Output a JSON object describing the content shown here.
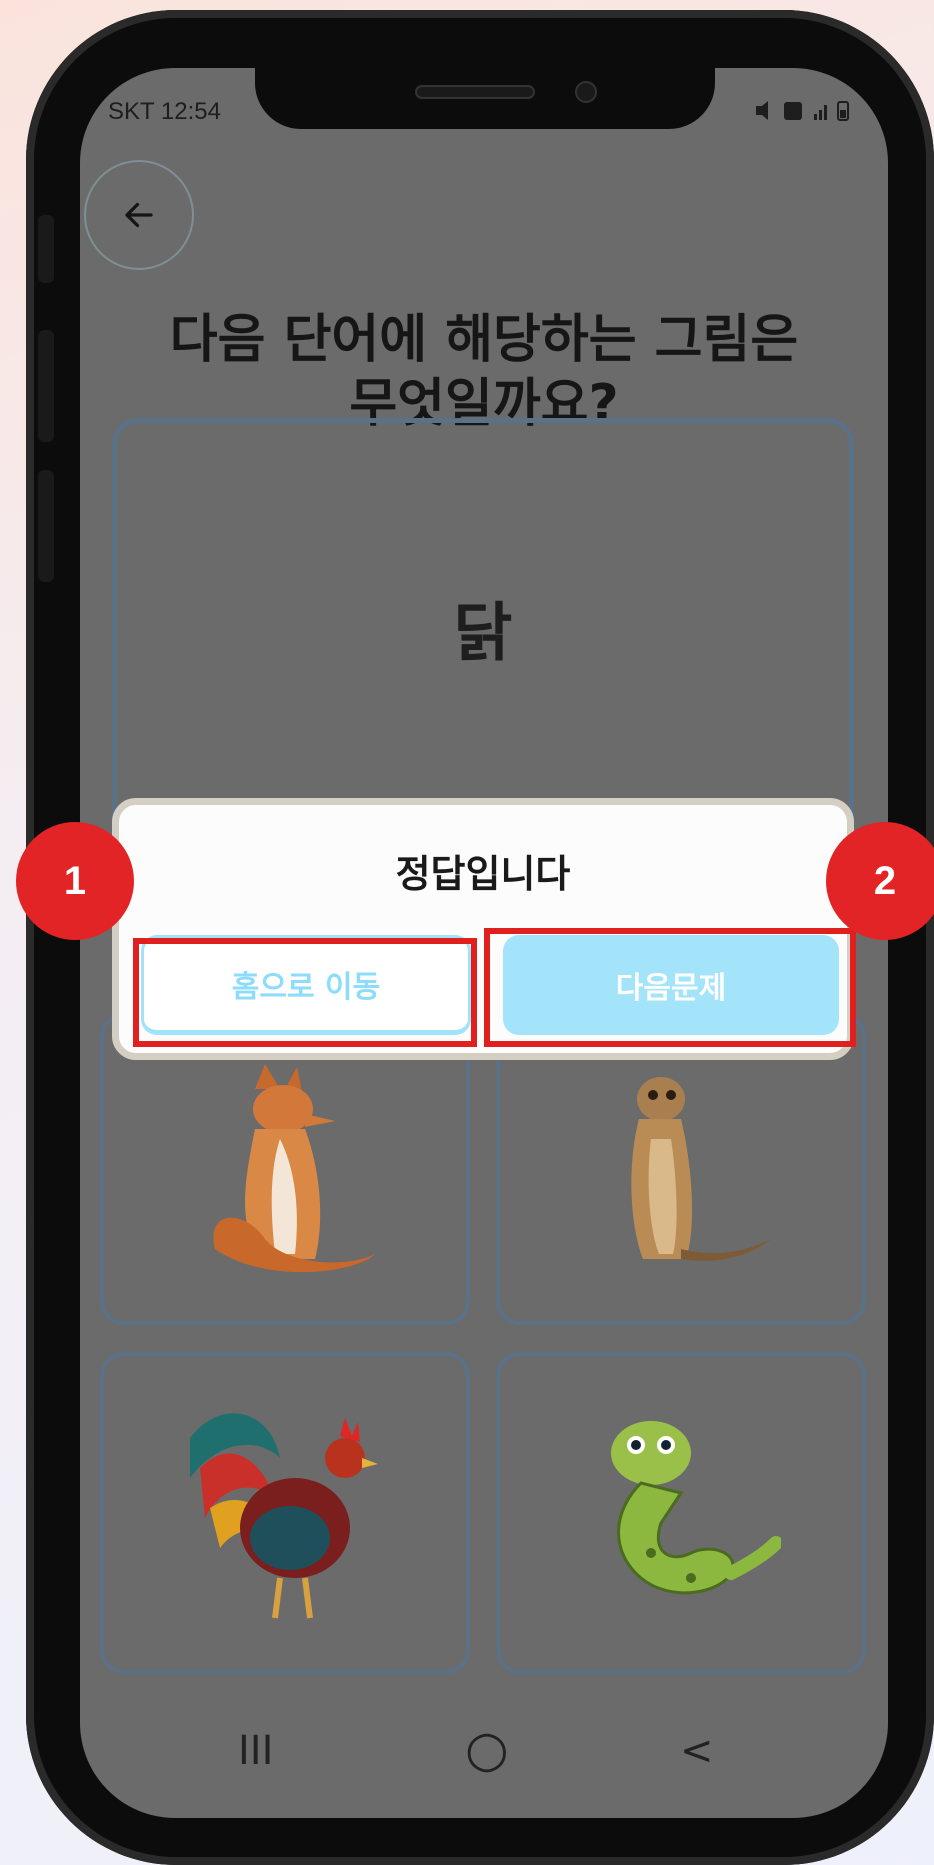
{
  "status_bar": {
    "carrier_time": "SKT 12:54",
    "icons": "mute-icon lte-icon signal-icon battery-icon"
  },
  "question": {
    "line1": "다음 단어에 해당하는 그림은",
    "line2": "무엇일까요?"
  },
  "word_card": {
    "word": "닭"
  },
  "choices": [
    {
      "animal": "fox"
    },
    {
      "animal": "meerkat"
    },
    {
      "animal": "rooster"
    },
    {
      "animal": "snake"
    }
  ],
  "dialog": {
    "title": "정답입니다",
    "home_button": "홈으로 이동",
    "next_button": "다음문제"
  },
  "nav_bar": {
    "recent": "III",
    "home": "○",
    "back": "<"
  },
  "annotations": {
    "marker1": "1",
    "marker2": "2"
  },
  "colors": {
    "accent": "#a3e4fb",
    "highlight": "#e01f1f",
    "marker": "#e32426"
  }
}
